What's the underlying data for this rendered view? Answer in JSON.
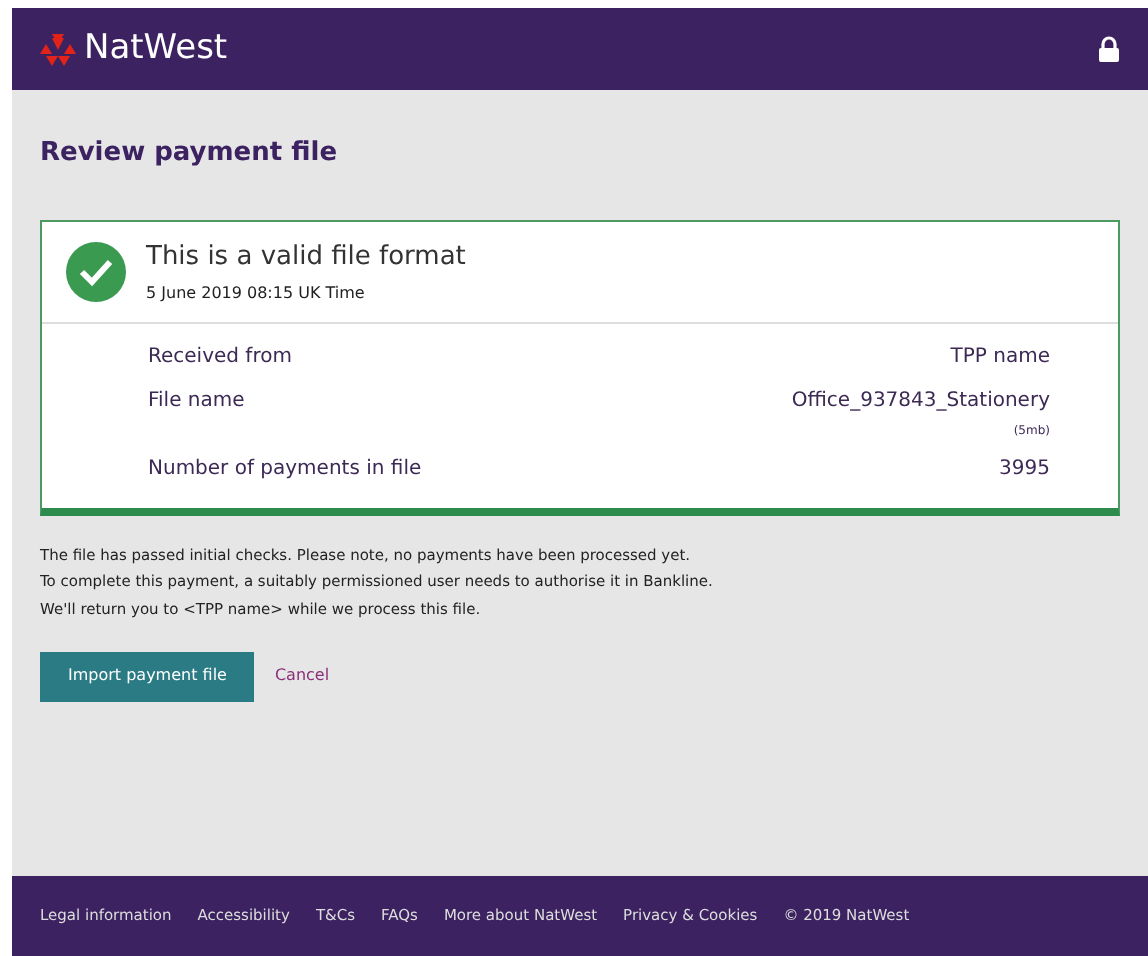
{
  "header": {
    "brand": "NatWest"
  },
  "page": {
    "title": "Review payment file"
  },
  "status_card": {
    "title": "This is a valid file format",
    "timestamp": "5 June 2019 08:15 UK Time",
    "rows": [
      {
        "label": "Received from",
        "value": "TPP name"
      },
      {
        "label": "File name",
        "value": "Office_937843_Stationery",
        "note": "(5mb)"
      },
      {
        "label": "Number of payments in file",
        "value": "3995"
      }
    ]
  },
  "info_lines": [
    "The file has passed initial checks. Please note, no payments have been processed yet.",
    "To complete this payment, a suitably permissioned user needs to authorise it in Bankline.",
    "We'll return you to <TPP name> while we process this file."
  ],
  "actions": {
    "primary": "Import payment file",
    "secondary": "Cancel"
  },
  "footer": {
    "links": [
      "Legal information",
      "Accessibility",
      "T&Cs",
      "FAQs",
      "More about NatWest",
      "Privacy & Cookies"
    ],
    "copyright": "© 2019 NatWest"
  }
}
